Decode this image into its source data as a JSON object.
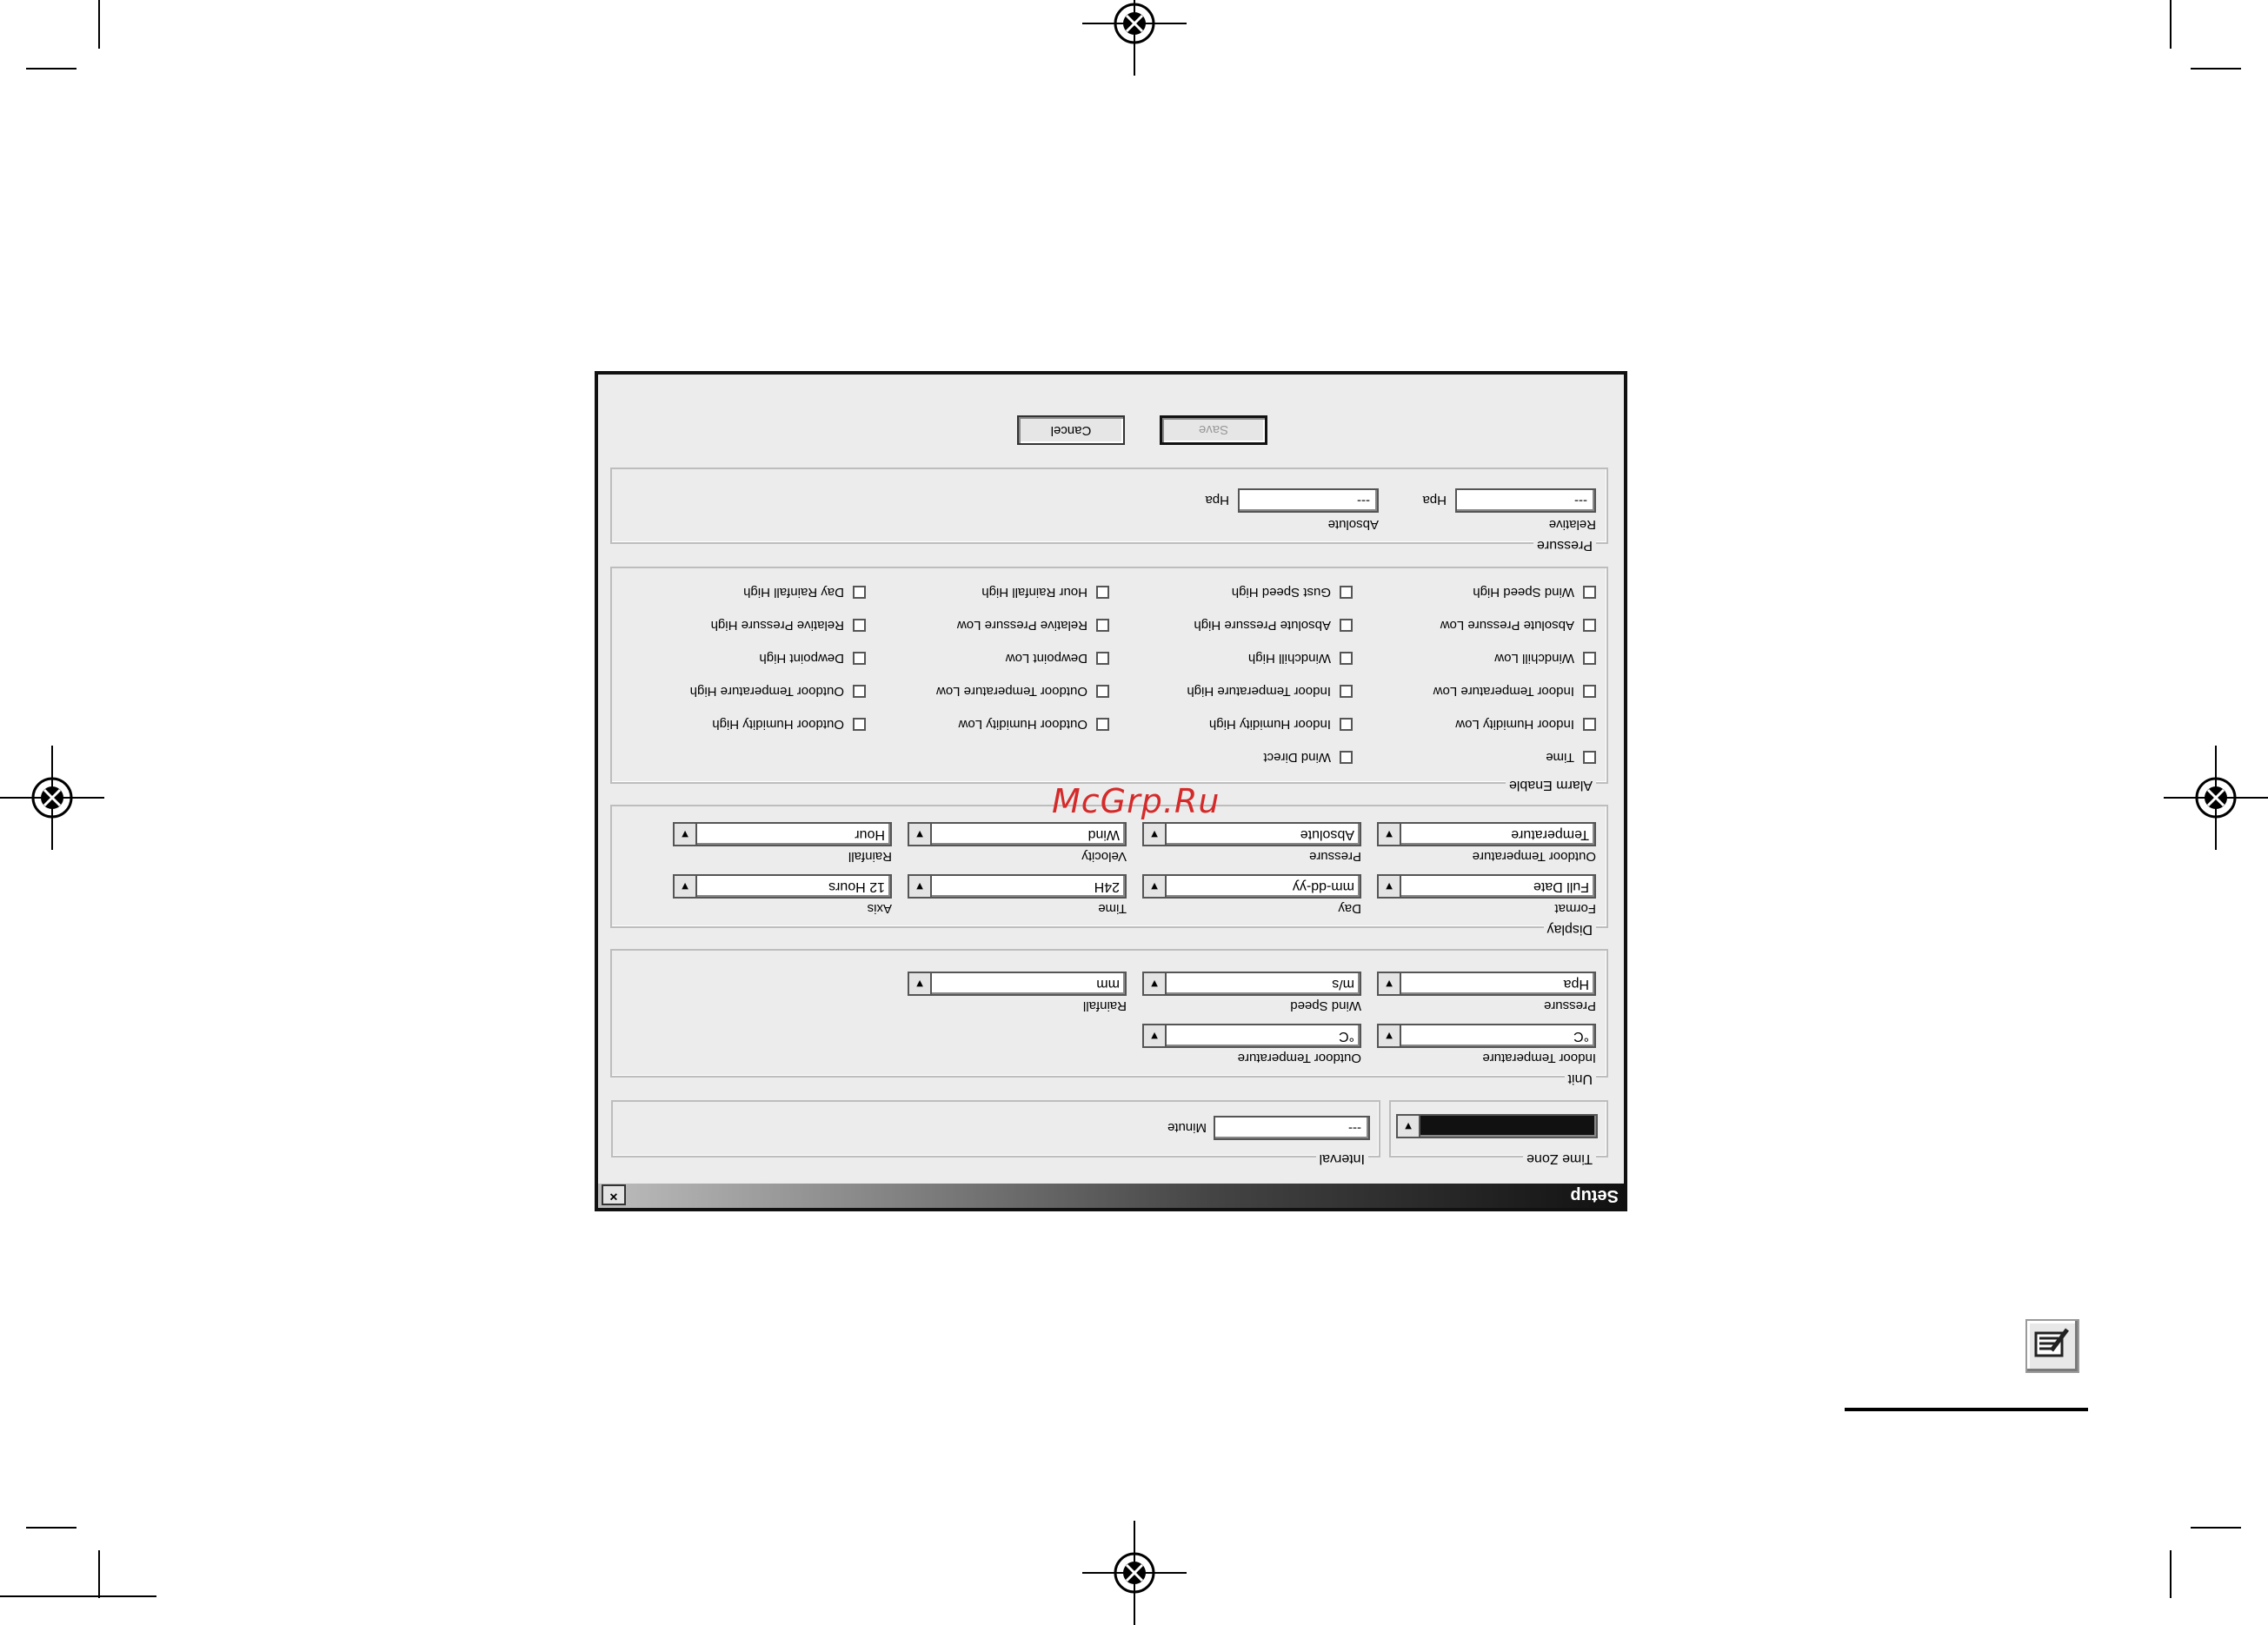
{
  "watermark": "McGrp.Ru",
  "dialog": {
    "title": "Setup",
    "close_symbol": "×",
    "time_zone": {
      "legend": "Time Zone",
      "value": ""
    },
    "interval": {
      "legend": "Interval",
      "value": "---",
      "unit": "Minute"
    },
    "unit": {
      "legend": "Unit",
      "indoor_temperature": {
        "label": "Indoor Temperature",
        "value": "°C"
      },
      "outdoor_temperature": {
        "label": "Outdoor Temperature",
        "value": "°C"
      },
      "pressure": {
        "label": "Pressure",
        "value": "Hpa"
      },
      "wind_speed": {
        "label": "Wind Speed",
        "value": "m/s"
      },
      "rainfall": {
        "label": "Rainfall",
        "value": "mm"
      }
    },
    "display": {
      "legend": "Display",
      "format_label": "Format",
      "day": {
        "label": "Day",
        "value": "mm-dd-yy"
      },
      "time": {
        "label": "Time",
        "value": "24H"
      },
      "axis": {
        "label": "Axis",
        "value": "12 Hours"
      },
      "format_value": "Full Date",
      "outdoor_temperature": {
        "label": "Outdoor Temperature",
        "value": "Temperature"
      },
      "pressure": {
        "label": "Pressure",
        "value": "Absolute"
      },
      "velocity": {
        "label": "Velocity",
        "value": "Wind"
      },
      "rainfall": {
        "label": "Rainfall",
        "value": "Hour"
      }
    },
    "alarm": {
      "legend": "Alarm Enable",
      "items": [
        "Time",
        "Wind Direct",
        "",
        "",
        "Indoor Humidity Low",
        "Indoor Humidity High",
        "Outdoor Humidity Low",
        "Outdoor Humidity High",
        "Indoor Temperature Low",
        "Indoor Temperature High",
        "Outdoor Temperature Low",
        "Outdoor Temperature High",
        "Windchill Low",
        "Windchill High",
        "Dewpoint Low",
        "Dewpoint High",
        "Absolute Pressure Low",
        "Absolute Pressure High",
        "Relative Pressure Low",
        "Relative Pressure High",
        "Wind Speed High",
        "Gust Speed High",
        "Hour Rainfall High",
        "Day Rainfall High"
      ]
    },
    "pressure": {
      "legend": "Pressure",
      "relative": {
        "label": "Relative",
        "value": "---",
        "unit": "Hpa"
      },
      "absolute": {
        "label": "Absolute",
        "value": "---",
        "unit": "Hpa"
      }
    },
    "buttons": {
      "save": "Save",
      "cancel": "Cancel"
    }
  }
}
